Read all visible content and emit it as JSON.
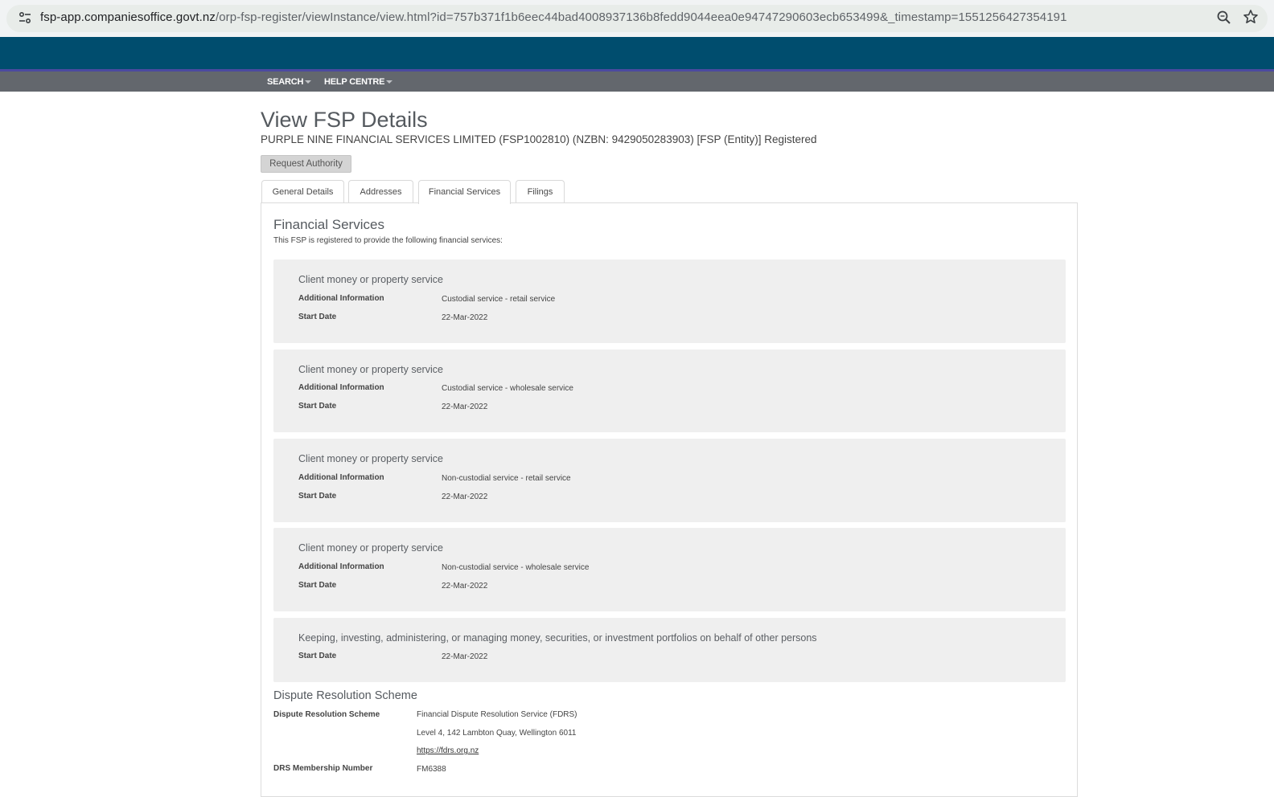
{
  "browser": {
    "url_host": "fsp-app.companiesoffice.govt.nz",
    "url_path": "/orp-fsp-register/viewInstance/view.html?id=757b371f1b6eec44bad4008937136b8fedd9044eea0e94747290603ecb653499&_timestamp=1551256427354191"
  },
  "nav": {
    "items": [
      {
        "label": "SEARCH"
      },
      {
        "label": "HELP CENTRE"
      }
    ]
  },
  "page": {
    "title": "View FSP Details",
    "subtitle": "PURPLE NINE FINANCIAL SERVICES LIMITED (FSP1002810) (NZBN: 9429050283903) [FSP (Entity)] Registered",
    "request_authority_label": "Request Authority"
  },
  "tabs": [
    {
      "label": "General Details",
      "active": false
    },
    {
      "label": "Addresses",
      "active": false
    },
    {
      "label": "Financial Services",
      "active": true
    },
    {
      "label": "Filings",
      "active": false
    }
  ],
  "financial_services": {
    "heading": "Financial Services",
    "intro": "This FSP is registered to provide the following financial services:",
    "additional_info_label": "Additional Information",
    "start_date_label": "Start Date",
    "services": [
      {
        "title": "Client money or property service",
        "additional_information": "Custodial service - retail service",
        "start_date": "22-Mar-2022"
      },
      {
        "title": "Client money or property service",
        "additional_information": "Custodial service - wholesale service",
        "start_date": "22-Mar-2022"
      },
      {
        "title": "Client money or property service",
        "additional_information": "Non-custodial service - retail service",
        "start_date": "22-Mar-2022"
      },
      {
        "title": "Client money or property service",
        "additional_information": "Non-custodial service - wholesale service",
        "start_date": "22-Mar-2022"
      },
      {
        "title": "Keeping, investing, administering, or managing money, securities, or investment portfolios on behalf of other persons",
        "start_date": "22-Mar-2022"
      }
    ]
  },
  "dispute_resolution": {
    "heading": "Dispute Resolution Scheme",
    "scheme_label": "Dispute Resolution Scheme",
    "scheme_name": "Financial Dispute Resolution Service (FDRS)",
    "scheme_address": "Level 4, 142 Lambton Quay, Wellington 6011",
    "scheme_url": "https://fdrs.org.nz",
    "membership_label": "DRS Membership Number",
    "membership_number": "FM6388"
  },
  "colors": {
    "brand_bar": "#004d6e",
    "nav_bar": "#63676d",
    "card_bg": "#efefef"
  }
}
